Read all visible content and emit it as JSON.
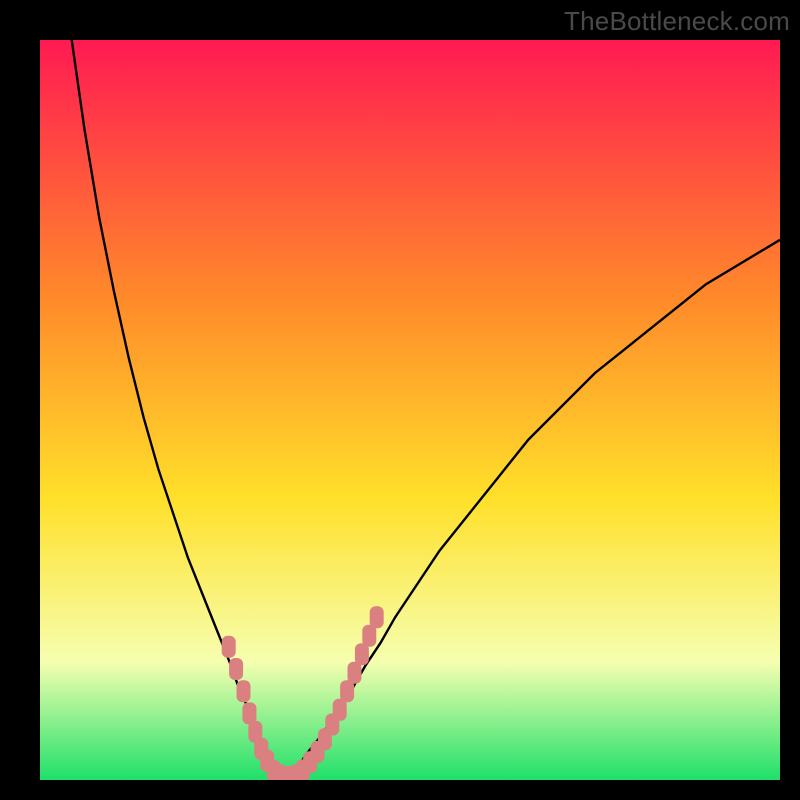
{
  "watermark": "TheBottleneck.com",
  "colors": {
    "gradient_top": "#ff1a52",
    "gradient_mid1": "#ff8a2a",
    "gradient_mid2": "#ffe02a",
    "gradient_mid3": "#f6ffb0",
    "gradient_bottom": "#1fe06a",
    "curve": "#000000",
    "markers": "#db8080",
    "frame": "#000000"
  },
  "chart_data": {
    "type": "line",
    "title": "",
    "xlabel": "",
    "ylabel": "",
    "xlim": [
      0,
      100
    ],
    "ylim": [
      0,
      100
    ],
    "grid": false,
    "legend": false,
    "curve_left": {
      "x": [
        4,
        6,
        8,
        10,
        12,
        14,
        16,
        18,
        20,
        22,
        24,
        26,
        27,
        28,
        29,
        30,
        31,
        32,
        33
      ],
      "y": [
        102,
        88,
        76,
        66,
        57,
        49,
        42,
        36,
        30,
        25,
        20,
        15,
        12,
        10,
        7,
        5,
        3,
        1.5,
        0.5
      ]
    },
    "curve_right": {
      "x": [
        33,
        34,
        35,
        36,
        38,
        40,
        42,
        44,
        46,
        48,
        50,
        54,
        58,
        62,
        66,
        70,
        75,
        80,
        85,
        90,
        95,
        100
      ],
      "y": [
        0.5,
        1,
        2,
        3.5,
        6,
        9,
        12,
        15.5,
        18.5,
        22,
        25,
        31,
        36,
        41,
        46,
        50,
        55,
        59,
        63,
        67,
        70,
        73
      ]
    },
    "marker_clusters": [
      {
        "side": "left",
        "points": [
          {
            "x": 25.5,
            "y": 18
          },
          {
            "x": 26.5,
            "y": 15
          },
          {
            "x": 27.5,
            "y": 12
          },
          {
            "x": 28.3,
            "y": 9
          },
          {
            "x": 29.1,
            "y": 6.5
          },
          {
            "x": 29.9,
            "y": 4.2
          },
          {
            "x": 30.7,
            "y": 2.6
          },
          {
            "x": 31.6,
            "y": 1.2
          },
          {
            "x": 32.5,
            "y": 0.6
          },
          {
            "x": 33.5,
            "y": 0.4
          }
        ]
      },
      {
        "side": "right",
        "points": [
          {
            "x": 34.5,
            "y": 0.6
          },
          {
            "x": 35.5,
            "y": 1.3
          },
          {
            "x": 36.5,
            "y": 2.4
          },
          {
            "x": 37.5,
            "y": 3.8
          },
          {
            "x": 38.5,
            "y": 5.5
          },
          {
            "x": 39.5,
            "y": 7.5
          },
          {
            "x": 40.5,
            "y": 9.5
          },
          {
            "x": 41.5,
            "y": 12
          },
          {
            "x": 42.5,
            "y": 14.5
          },
          {
            "x": 43.5,
            "y": 17
          },
          {
            "x": 44.5,
            "y": 19.5
          },
          {
            "x": 45.5,
            "y": 22
          }
        ]
      }
    ]
  }
}
